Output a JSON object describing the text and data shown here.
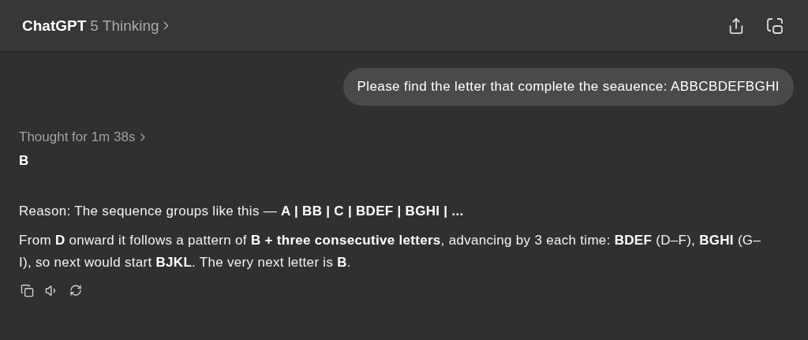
{
  "header": {
    "title": "ChatGPT",
    "model": "5 Thinking"
  },
  "user_message": "Please find the letter that complete the seauence: ABBCBDEFBGHI",
  "assistant": {
    "thought": "Thought for 1m 38s",
    "answer": "B",
    "paragraphs": [
      "Reason: The sequence groups like this — **A | BB | C | BDEF | BGHI | ...**",
      "From **D** onward it follows a pattern of **B + three consecutive letters**, advancing by 3 each time: **BDEF** (D–F), **BGHI** (G–I), so next would start **BJKL**. The very next letter is **B**."
    ]
  }
}
